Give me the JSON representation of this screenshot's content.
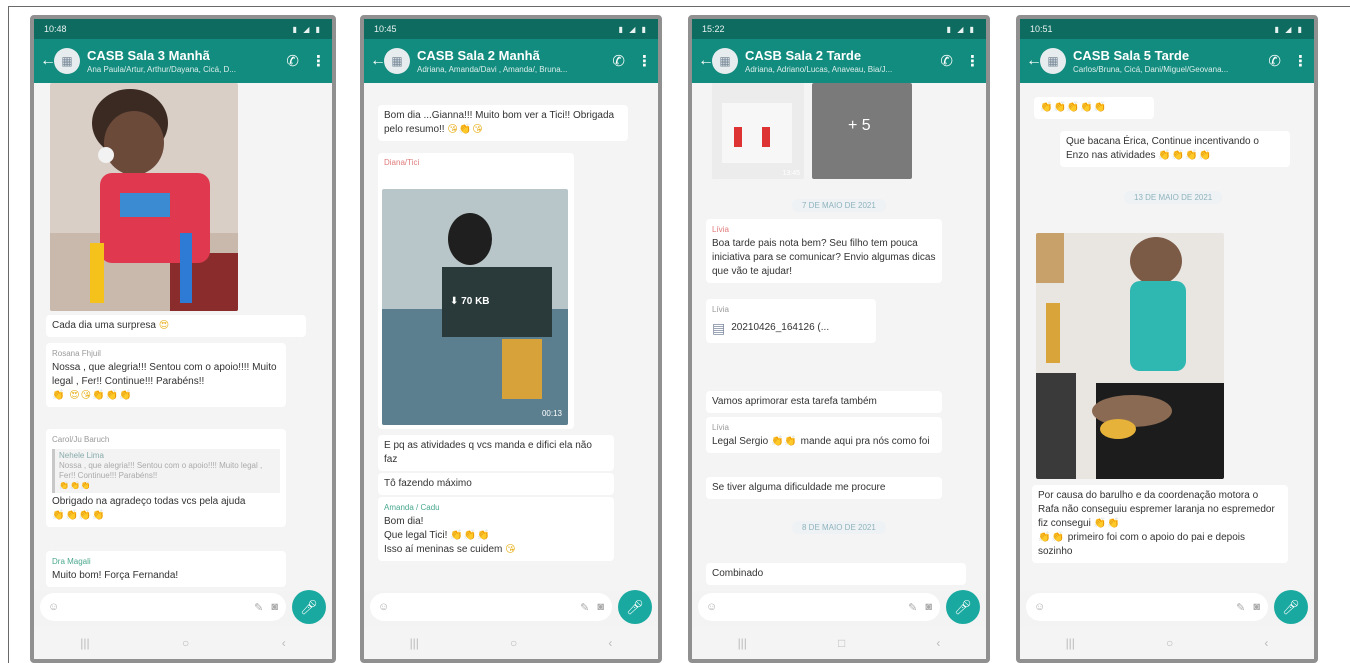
{
  "phones": [
    {
      "time": "10:48",
      "title": "CASB Sala 3 Manhã",
      "subtitle": "Ana Paula/Artur, Arthur/Dayana, Cicá, D...",
      "messages": {
        "m1_text": "Cada dia  uma surpresa",
        "m1_emoji": "😍",
        "m2_sender": "Rosana Fhjuil",
        "m2_text": "Nossa , que alegria!!! Sentou com o apoio!!!! Muito legal , Fer!! Continue!!! Parabéns!!",
        "m2_emoji": "👏 😍😘👏👏👏",
        "m3_sender": "Carol/Ju Baruch",
        "m3_quote_name": "Nehele Lima",
        "m3_quote_text": "Nossa , que alegria!!! Sentou com o apoio!!!! Muito legal , Fer!! Continue!!! Parabéns!!",
        "m3_quote_emoji": "👏👏👏",
        "m3_text": "Obrigado na agradeço todas vcs pela ajuda",
        "m3_emoji": "👏👏👏👏",
        "m4_sender": "Dra Magali",
        "m4_text": "Muito bom! Força Fernanda!"
      }
    },
    {
      "time": "10:45",
      "title": "CASB Sala 2 Manhã",
      "subtitle": "Adriana, Amanda/Davi , Amanda/, Bruna...",
      "messages": {
        "m1_text": "Bom dia ...Gianna!!! Muito bom ver a Tici!! Obrigada pelo resumo!!",
        "m1_emoji": "😘👏😘",
        "m2_sender": "Diana/Tici",
        "video_size": "70 KB",
        "video_duration": "00:13",
        "m3_text": "E pq as atividades q vcs manda e difici ela não faz",
        "m4_text": "Tô fazendo máximo",
        "m5_sender": "Amanda / Cadu",
        "m5_line1": "Bom dia!",
        "m5_line2": "Que legal Tici!",
        "m5_line2_emoji": "👏👏👏",
        "m5_line3": "Isso aí meninas se cuidem",
        "m5_line3_emoji": "😘"
      }
    },
    {
      "time": "15:22",
      "title": "CASB Sala 2 Tarde",
      "subtitle": "Adriana, Adriano/Lucas, Anaveau, Bia/J...",
      "messages": {
        "img_more": "+ 5",
        "img_time": "13:45",
        "date1": "7 DE MAIO DE 2021",
        "m1_sender": "Lívia",
        "m1_text": "Boa tarde pais nota bem? Seu filho tem pouca iniciativa para se comunicar? Envio algumas dicas que vão te ajudar!",
        "m2_sender": "Lívia",
        "m2_file": "20210426_164126 (...",
        "m3_text": "Vamos aprimorar esta tarefa também",
        "m4_sender": "Lívia",
        "m4_text": "Legal Sergio",
        "m4_emoji": "👏👏",
        "m4_text2": "mande aqui pra nós como foi",
        "m5_text": "Se tiver alguma dificuldade me procure",
        "date2": "8 DE MAIO DE 2021",
        "m6_text": "Combinado"
      }
    },
    {
      "time": "10:51",
      "title": "CASB Sala 5 Tarde",
      "subtitle": "Carlos/Bruna, Cicá, Dani/Miguel/Geovana...",
      "messages": {
        "m0_emoji": "👏👏👏👏👏",
        "m1_text": "Que bacana Érica, Continue incentivando o Enzo nas atividades",
        "m1_emoji": "👏👏👏👏",
        "date1": "13 DE MAIO DE 2021",
        "m2_text": "Por causa do barulho e da coordenação motora o Rafa não conseguiu espremer laranja no espremedor fiz consegui",
        "m2_emoji": "👏👏",
        "m2_text2": "primeiro foi com o apoio do pai e depois sozinho",
        "m2_emoji2": "👏👏"
      }
    }
  ],
  "colors": {
    "header": "#128c7e",
    "statusbar": "#0e6b60",
    "mic": "#1aa9a0",
    "chat_bg": "#f4f4f4"
  },
  "icons": [
    "back-arrow-icon",
    "group-avatar-icon",
    "add-call-icon",
    "more-vert-icon",
    "emoji-icon",
    "attach-icon",
    "camera-icon",
    "mic-icon",
    "download-icon",
    "document-icon"
  ]
}
